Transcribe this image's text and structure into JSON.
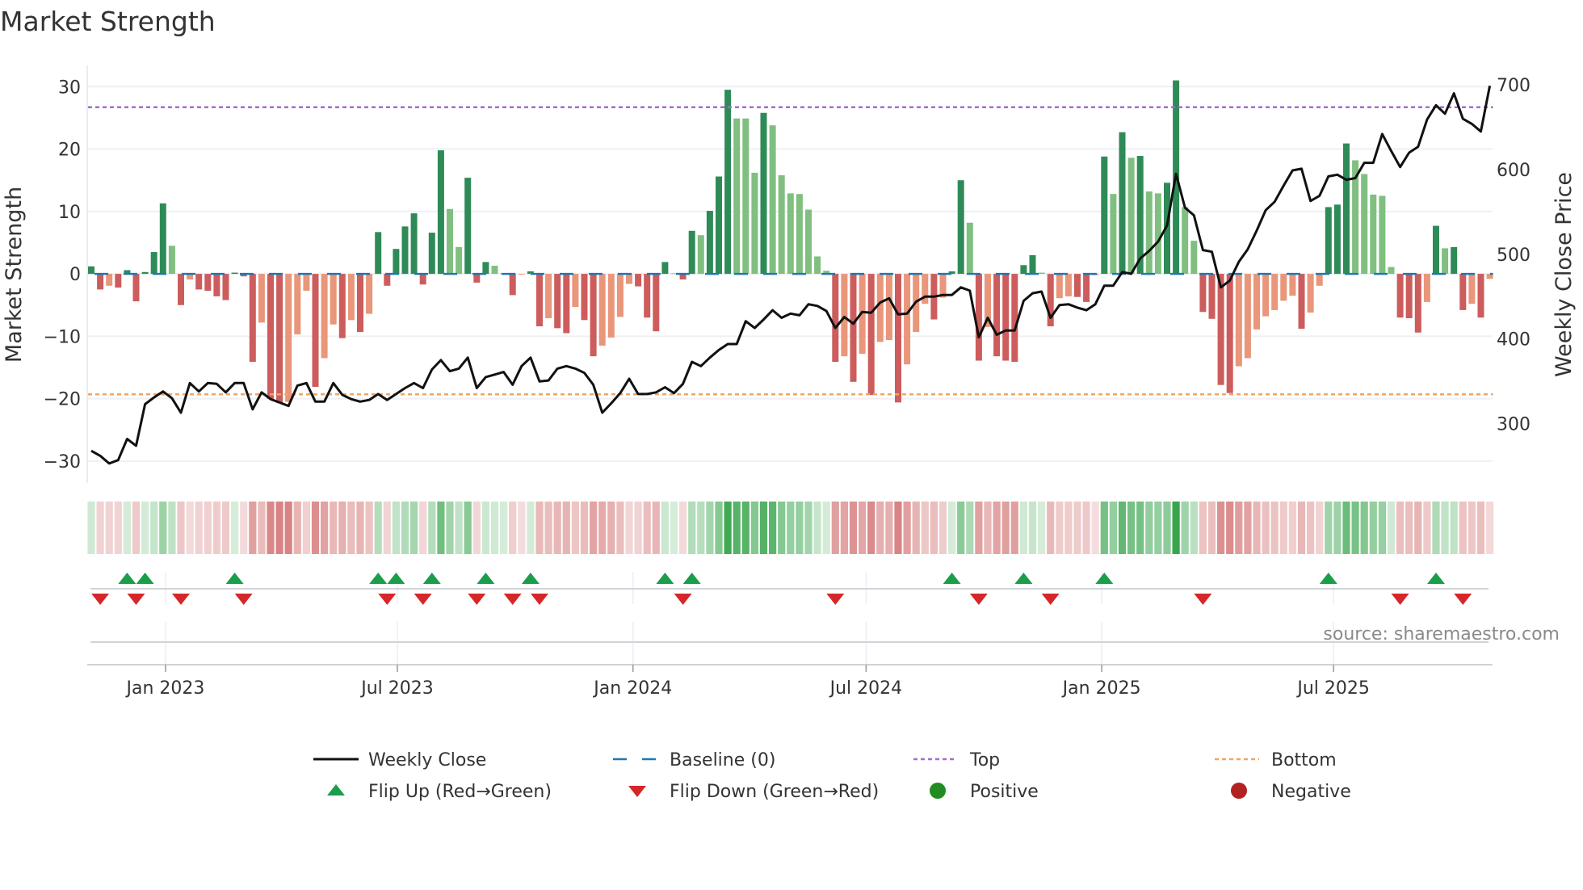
{
  "title": "Market Strength",
  "source_note": "source: sharemaestro.com",
  "colors": {
    "up_strong": "#2e8b57",
    "up_weak": "#80bf80",
    "down_strong": "#cd5c5c",
    "down_weak": "#e9967a",
    "baseline": "#1f77b4",
    "top": "#a66ad6",
    "bottom": "#f4a460",
    "price": "#111111",
    "flip_up": "#1a9e4a",
    "flip_down": "#d62728",
    "heat_pos": "46,160,67",
    "heat_neg": "200,80,80",
    "positive": "#228b22",
    "negative": "#b22222"
  },
  "legend": {
    "weekly_close": "Weekly Close",
    "baseline": "Baseline (0)",
    "top": "Top",
    "bottom": "Bottom",
    "flip_up": "Flip Up (Red→Green)",
    "flip_down": "Flip Down (Green→Red)",
    "positive": "Positive",
    "negative": "Negative"
  },
  "chart_data": {
    "type": "bar",
    "title": "Market Strength",
    "ylabel": "Market Strength",
    "y2label": "Weekly Close Price",
    "ylim": [
      -33.5,
      33.4
    ],
    "y2lim": [
      230,
      723
    ],
    "yticks": [
      30,
      20,
      10,
      0,
      -10,
      -20,
      -30
    ],
    "ytick_labels": [
      "30",
      "20",
      "10",
      "0",
      "−10",
      "−20",
      "−30"
    ],
    "y2ticks": [
      700,
      600,
      500,
      400,
      300
    ],
    "y2tick_labels": [
      "700",
      "600",
      "500",
      "400",
      "300"
    ],
    "start_date": "2022-11-04",
    "frequency": "weekly",
    "xticks": [
      "2023-01-01",
      "2023-07-01",
      "2024-01-01",
      "2024-07-01",
      "2025-01-01",
      "2025-07-01"
    ],
    "xtick_labels": [
      "Jan 2023",
      "Jul 2023",
      "Jan 2024",
      "Jul 2024",
      "Jan 2025",
      "Jul 2025"
    ],
    "top_level": 26.7,
    "bottom_level": -19.3,
    "baseline_level": 0,
    "grid": true,
    "legend_position": "bottom",
    "strength": [
      1.2,
      -2.5,
      -1.9,
      -2.2,
      0.6,
      -4.4,
      0.3,
      3.5,
      11.3,
      4.5,
      -5.0,
      -0.9,
      -2.5,
      -2.7,
      -3.6,
      -4.2,
      0.2,
      -0.4,
      -14.1,
      -7.8,
      -20.0,
      -20.7,
      -20.5,
      -9.7,
      -2.7,
      -18.1,
      -13.5,
      -8.1,
      -10.3,
      -7.4,
      -9.3,
      -6.4,
      6.7,
      -1.9,
      4.0,
      7.6,
      9.7,
      -1.7,
      6.6,
      19.8,
      10.4,
      4.3,
      15.4,
      -1.4,
      1.9,
      1.3,
      0.1,
      -3.4,
      -0.1,
      0.4,
      -8.4,
      -7.1,
      -8.7,
      -9.5,
      -5.3,
      -7.4,
      -13.2,
      -11.5,
      -10.2,
      -6.9,
      -1.6,
      -2.0,
      -7.0,
      -9.2,
      1.9,
      0.1,
      -0.9,
      6.9,
      6.2,
      10.1,
      15.6,
      29.5,
      24.9,
      24.9,
      16.2,
      25.8,
      23.8,
      15.8,
      12.9,
      12.8,
      10.3,
      2.8,
      0.5,
      -14.1,
      -13.2,
      -17.3,
      -12.8,
      -19.4,
      -10.9,
      -10.6,
      -20.6,
      -14.5,
      -9.3,
      -4.8,
      -7.3,
      -3.8,
      0.4,
      15.0,
      8.2,
      -13.9,
      -8.5,
      -13.2,
      -13.9,
      -14.1,
      1.4,
      3.0,
      0.2,
      -8.4,
      -3.9,
      -3.6,
      -3.7,
      -4.5,
      -0.2,
      18.8,
      12.8,
      22.7,
      18.6,
      18.9,
      13.2,
      12.9,
      14.6,
      31.0,
      10.7,
      5.3,
      -6.1,
      -7.2,
      -17.8,
      -19.1,
      -14.8,
      -13.5,
      -8.9,
      -6.8,
      -5.8,
      -4.3,
      -3.5,
      -8.8,
      -6.2,
      -1.9,
      10.7,
      11.1,
      20.9,
      18.2,
      16.0,
      12.7,
      12.5,
      1.1,
      -7.0,
      -7.1,
      -9.4,
      -4.5,
      7.7,
      4.1,
      4.3,
      -5.8,
      -4.8,
      -7.0,
      -0.8
    ],
    "weekly_close": [
      268,
      262,
      253,
      257,
      282,
      274,
      323,
      331,
      338,
      330,
      313,
      348,
      338,
      348,
      347,
      337,
      348,
      348,
      317,
      337,
      329,
      325,
      321,
      345,
      348,
      326,
      326,
      348,
      334,
      329,
      326,
      328,
      335,
      328,
      335,
      342,
      348,
      342,
      364,
      375,
      362,
      365,
      378,
      342,
      355,
      358,
      361,
      346,
      368,
      378,
      350,
      351,
      365,
      368,
      365,
      360,
      346,
      313,
      324,
      336,
      353,
      335,
      335,
      337,
      343,
      336,
      347,
      373,
      368,
      378,
      387,
      394,
      394,
      421,
      413,
      423,
      434,
      425,
      430,
      428,
      441,
      439,
      433,
      413,
      426,
      418,
      432,
      431,
      443,
      448,
      429,
      430,
      444,
      450,
      450,
      452,
      452,
      461,
      457,
      402,
      425,
      405,
      410,
      410,
      445,
      454,
      456,
      425,
      440,
      441,
      437,
      434,
      441,
      463,
      463,
      479,
      477,
      495,
      504,
      515,
      534,
      595,
      555,
      546,
      505,
      503,
      461,
      469,
      491,
      506,
      528,
      552,
      562,
      581,
      599,
      601,
      563,
      569,
      592,
      594,
      588,
      590,
      608,
      608,
      642,
      622,
      603,
      620,
      627,
      659,
      676,
      666,
      690,
      660,
      654,
      645,
      699
    ]
  }
}
